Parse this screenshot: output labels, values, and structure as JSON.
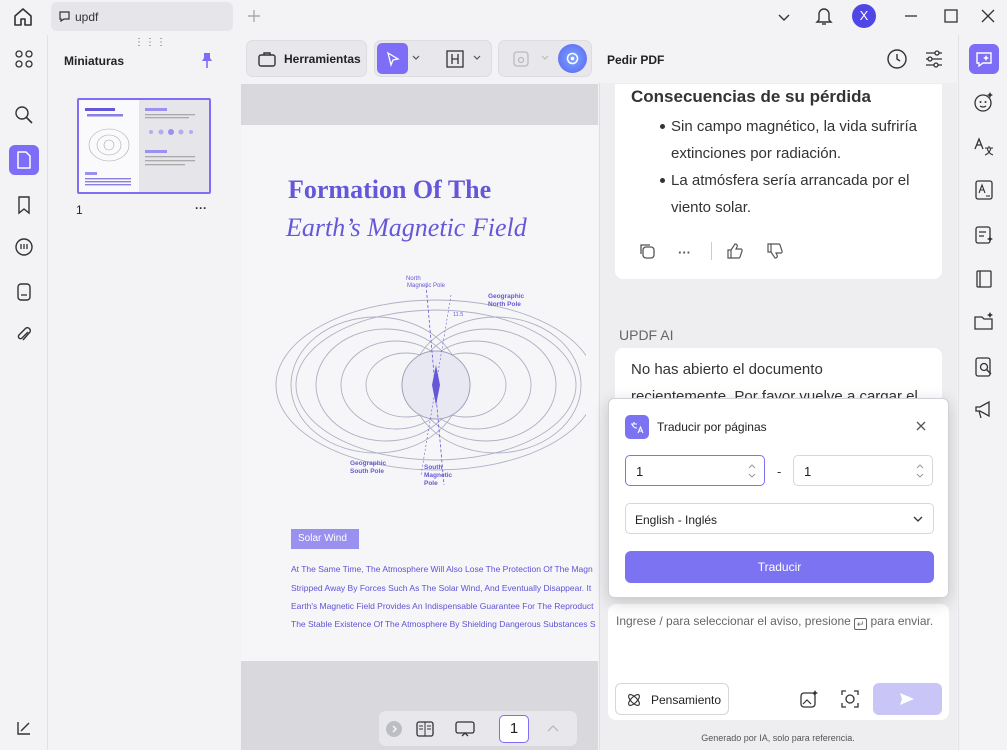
{
  "topbar": {
    "tab_label": "updf"
  },
  "thumbs": {
    "title": "Miniaturas",
    "page_number": "1",
    "more": "···"
  },
  "toolbar": {
    "tools_label": "Herramientas"
  },
  "doc": {
    "title1": "Formation Of The",
    "title2": "Earth’s Magnetic Field",
    "labels": {
      "north_magnetic": "North\nMagnetic Pole",
      "geo_north": "Geographic\nNorth Pole",
      "geo_south": "Geographic\nSouth Pole",
      "south_magnetic": "South\nMagnetic\nPole",
      "angle": "11.5"
    },
    "solar_tag": "Solar Wind",
    "body": [
      "At The Same Time, The Atmosphere Will Also Lose The Protection Of The Magn",
      "Stripped Away By Forces Such As The Solar Wind, And Eventually Disappear. It",
      "Earth's Magnetic Field Provides An Indispensable Guarantee For The Reproduct",
      "The Stable Existence Of The Atmosphere By Shielding Dangerous Substances S"
    ]
  },
  "pagenav": {
    "current": "1"
  },
  "ask": {
    "title": "Pedir PDF",
    "partial_heading": "Consecuencias de su pérdida",
    "bullets": [
      "Sin campo magnético, la vida sufriría",
      "extinciones por radiación.",
      "La atmósfera sería arrancada por el",
      "viento solar."
    ],
    "ai_label": "UPDF AI",
    "ai_msg_1": "No has abierto el documento",
    "ai_msg_2": "recientemente. Por favor vuelve a cargar el",
    "input_placeholder_a": "Ingrese / para seleccionar el aviso, presione",
    "input_placeholder_b": "para enviar.",
    "think_label": "Pensamiento",
    "footer": "Generado por IA, solo para referencia."
  },
  "popup": {
    "title": "Traducir por páginas",
    "from_page": "1",
    "dash": "-",
    "to_page": "1",
    "language": "English - Inglés",
    "button": "Traducir"
  },
  "user": {
    "avatar_letter": "X"
  },
  "colors": {
    "accent": "#7d6df7",
    "doc_text": "#6558d8",
    "button": "#7b73f2"
  }
}
